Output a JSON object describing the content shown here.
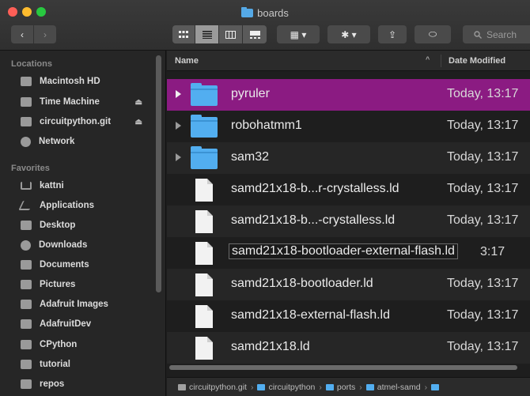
{
  "window": {
    "title": "boards"
  },
  "toolbar": {
    "back_glyph": "‹",
    "forward_glyph": "›",
    "view_icons": [
      "icon-view-icon",
      "list-view-icon",
      "column-view-icon",
      "gallery-view-icon"
    ],
    "group_glyph": "▦ ▾",
    "action_glyph": "✱ ▾",
    "share_glyph": "⇪",
    "tag_glyph": "⬭",
    "search_placeholder": "Search"
  },
  "sidebar": {
    "locations_header": "Locations",
    "locations": [
      {
        "label": "Macintosh HD",
        "icon": "disk-icon",
        "eject": false
      },
      {
        "label": "Time Machine",
        "icon": "time-machine-icon",
        "eject": true
      },
      {
        "label": "circuitpython.git",
        "icon": "disk-icon",
        "eject": true
      },
      {
        "label": "Network",
        "icon": "network-icon",
        "eject": false
      }
    ],
    "favorites_header": "Favorites",
    "favorites": [
      {
        "label": "kattni",
        "icon": "home-icon"
      },
      {
        "label": "Applications",
        "icon": "applications-icon"
      },
      {
        "label": "Desktop",
        "icon": "desktop-icon"
      },
      {
        "label": "Downloads",
        "icon": "downloads-icon"
      },
      {
        "label": "Documents",
        "icon": "documents-icon"
      },
      {
        "label": "Pictures",
        "icon": "pictures-icon"
      },
      {
        "label": "Adafruit Images",
        "icon": "folder-icon"
      },
      {
        "label": "AdafruitDev",
        "icon": "folder-icon"
      },
      {
        "label": "CPython",
        "icon": "folder-icon"
      },
      {
        "label": "tutorial",
        "icon": "folder-icon"
      },
      {
        "label": "repos",
        "icon": "folder-icon"
      }
    ],
    "eject_glyph": "⏏"
  },
  "file_list": {
    "columns": {
      "name": "Name",
      "date_modified": "Date Modified",
      "sort_glyph": "^"
    },
    "rows": [
      {
        "name": "pyruler",
        "date": "Today, 13:17",
        "kind": "folder",
        "selected": true
      },
      {
        "name": "robohatmm1",
        "date": "Today, 13:17",
        "kind": "folder"
      },
      {
        "name": "sam32",
        "date": "Today, 13:17",
        "kind": "folder"
      },
      {
        "name": "samd21x18-b...r-crystalless.ld",
        "date": "Today, 13:17",
        "kind": "file"
      },
      {
        "name": "samd21x18-b...-crystalless.ld",
        "date": "Today, 13:17",
        "kind": "file"
      },
      {
        "name": "samd21x18-bootloader-external-flash.ld",
        "date": "3:17",
        "kind": "file",
        "editing": true
      },
      {
        "name": "samd21x18-bootloader.ld",
        "date": "Today, 13:17",
        "kind": "file"
      },
      {
        "name": "samd21x18-external-flash.ld",
        "date": "Today, 13:17",
        "kind": "file"
      },
      {
        "name": "samd21x18.ld",
        "date": "Today, 13:17",
        "kind": "file"
      }
    ]
  },
  "path_bar": {
    "segments": [
      "circuitpython.git",
      "circuitpython",
      "ports",
      "atmel-samd"
    ],
    "separator": "›"
  },
  "colors": {
    "selection": "#8b1b82",
    "folder": "#52aef0"
  }
}
